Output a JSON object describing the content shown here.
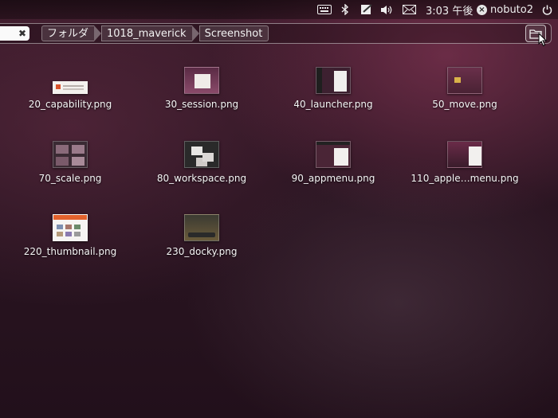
{
  "panel": {
    "clock": "3:03 午後",
    "user": "nobuto2",
    "indicators": [
      "keyboard-icon",
      "bluetooth-icon",
      "notes-icon",
      "volume-icon",
      "mail-icon"
    ]
  },
  "search": {
    "value": ""
  },
  "breadcrumb": [
    "フォルダ",
    "1018_maverick",
    "Screenshot"
  ],
  "files": [
    {
      "label": "20_capability.png",
      "thumb": "cap"
    },
    {
      "label": "30_session.png",
      "thumb": "sess"
    },
    {
      "label": "40_launcher.png",
      "thumb": "launch"
    },
    {
      "label": "50_move.png",
      "thumb": "move"
    },
    {
      "label": "70_scale.png",
      "thumb": "scale"
    },
    {
      "label": "80_workspace.png",
      "thumb": "work"
    },
    {
      "label": "90_appmenu.png",
      "thumb": "app"
    },
    {
      "label": "110_apple…menu.png",
      "thumb": "apple"
    },
    {
      "label": "220_thumbnail.png",
      "thumb": "thumb"
    },
    {
      "label": "230_docky.png",
      "thumb": "docky"
    }
  ]
}
